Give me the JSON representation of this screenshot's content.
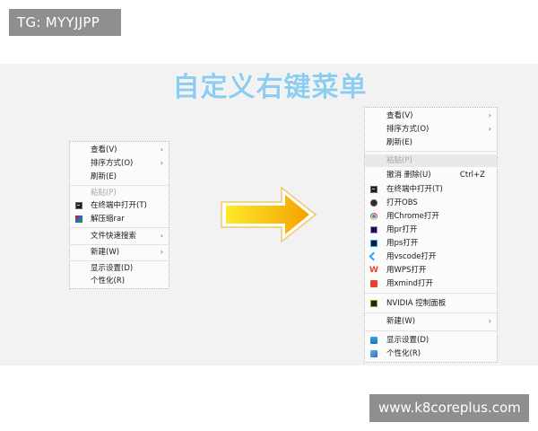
{
  "watermarks": {
    "top_left": "TG: MYYJJPP",
    "bottom_right": "www.k8coreplus.com"
  },
  "title": "自定义右键菜单",
  "colors": {
    "title": "#8fcdf0",
    "arrow_start": "#ffe92a",
    "arrow_end": "#f6a200",
    "background": "#f2f2f2"
  },
  "left_menu": {
    "items": [
      {
        "label": "查看(V)",
        "submenu": true
      },
      {
        "label": "排序方式(O)",
        "submenu": true
      },
      {
        "label": "刷新(E)"
      },
      {
        "label": "粘贴(P)",
        "disabled": true
      },
      {
        "label": "在终端中打开(T)",
        "icon": "terminal-icon"
      },
      {
        "label": "解压缩rar",
        "icon": "winrar-icon"
      },
      {
        "label": "文件快速搜索",
        "submenu": true
      },
      {
        "label": "新建(W)",
        "submenu": true
      },
      {
        "label": "显示设置(D)"
      },
      {
        "label": "个性化(R)"
      }
    ],
    "chevron": "›"
  },
  "right_menu": {
    "items": [
      {
        "label": "查看(V)",
        "submenu": true
      },
      {
        "label": "排序方式(O)",
        "submenu": true
      },
      {
        "label": "刷新(E)"
      },
      {
        "label": "粘贴(P)",
        "disabled": true
      },
      {
        "label": "撤消 删除(U)",
        "shortcut": "Ctrl+Z"
      },
      {
        "label": "在终端中打开(T)",
        "icon": "terminal-icon"
      },
      {
        "label": "打开OBS",
        "icon": "obs-icon"
      },
      {
        "label": "用Chrome打开",
        "icon": "chrome-icon"
      },
      {
        "label": "用pr打开",
        "icon": "premiere-icon"
      },
      {
        "label": "用ps打开",
        "icon": "photoshop-icon"
      },
      {
        "label": "用vscode打开",
        "icon": "vscode-icon"
      },
      {
        "label": "用WPS打开",
        "icon": "wps-icon"
      },
      {
        "label": "用xmind打开",
        "icon": "xmind-icon"
      },
      {
        "label": "NVIDIA 控制面板",
        "icon": "nvidia-icon"
      },
      {
        "label": "新建(W)",
        "submenu": true
      },
      {
        "label": "显示设置(D)",
        "icon": "display-icon"
      },
      {
        "label": "个性化(R)",
        "icon": "personalize-icon"
      }
    ],
    "chevron": "›"
  }
}
